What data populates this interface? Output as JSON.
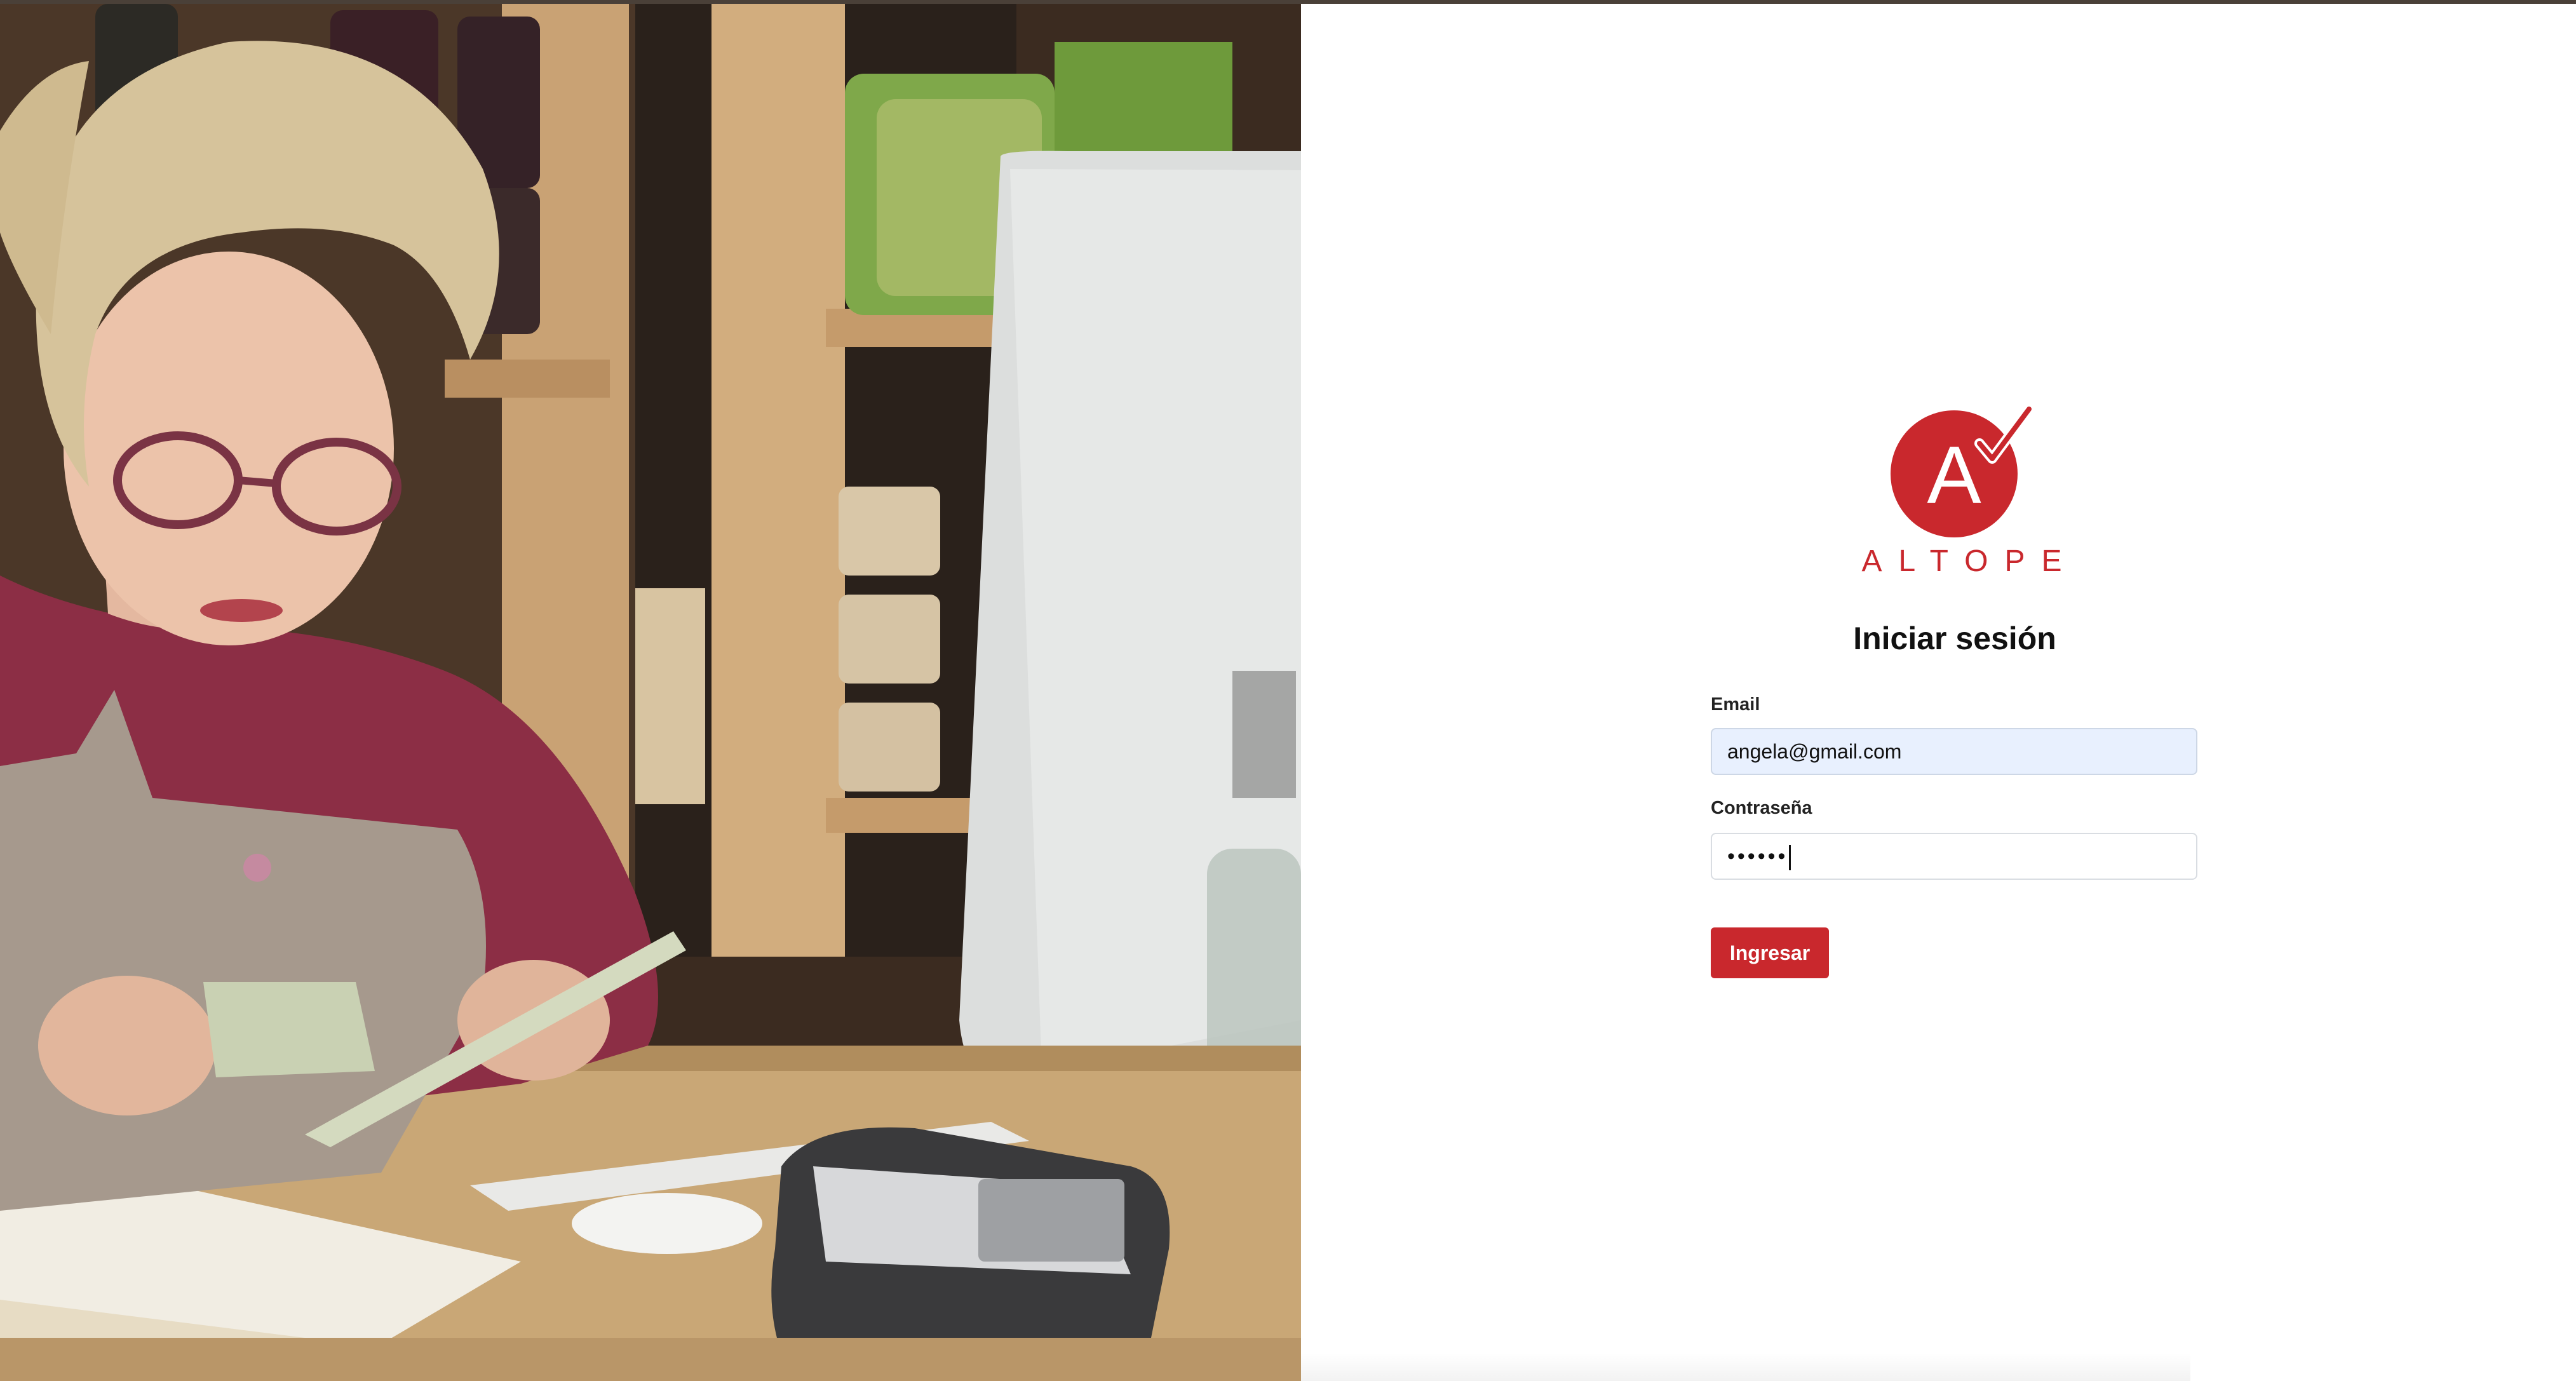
{
  "hero": {
    "description_icon": "photo-woman-counting-cash-at-register"
  },
  "brand": {
    "logo_letter": "A",
    "name": "ALTOPE",
    "color": "#c9282d"
  },
  "login": {
    "title": "Iniciar sesión",
    "email_label": "Email",
    "email_value": "angela@gmail.com",
    "password_label": "Contraseña",
    "password_masked": "••••••",
    "submit_label": "Ingresar"
  },
  "colors": {
    "accent": "#c9282d",
    "autofill_bg": "#e8f0fe",
    "topbar": "#4a4038"
  }
}
